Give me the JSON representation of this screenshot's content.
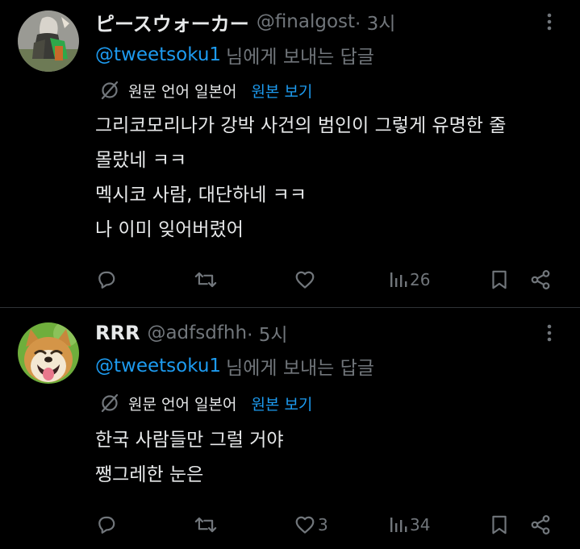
{
  "tweets": [
    {
      "name": "ピースウォーカー",
      "handle": "@finalgost",
      "time": " · 3시",
      "reply_mention": "@tweetsoku1",
      "reply_text": "님에게 보내는 답글",
      "translate_lang": "원문 언어 일본어",
      "translate_link": "원본 보기",
      "lines": [
        "그리코모리나가 강박 사건의 범인이 그렇게 유명한 줄",
        "몰랐네 ㅋㅋ",
        "멕시코 사람, 대단하네 ㅋㅋ",
        "나 이미 잊어버렸어"
      ],
      "stats": {
        "replies": "",
        "retweets": "",
        "likes": "",
        "views": "26"
      }
    },
    {
      "name": "RRR",
      "handle": "@adfsdfhh",
      "time": " · 5시",
      "reply_mention": "@tweetsoku1",
      "reply_text": "님에게 보내는 답글",
      "translate_lang": "원문 언어 일본어",
      "translate_link": "원본 보기",
      "lines": [
        "한국 사람들만 그럴 거야",
        "쨍그레한 눈은"
      ],
      "stats": {
        "replies": "",
        "retweets": "",
        "likes": "3",
        "views": "34"
      }
    }
  ],
  "icons": {
    "reply": "reply-icon",
    "retweet": "retweet-icon",
    "like": "heart-icon",
    "views": "views-bar-icon",
    "bookmark": "bookmark-icon",
    "share": "share-icon",
    "more": "more-vertical-icon",
    "translate": "translate-icon"
  },
  "colors": {
    "background": "#000000",
    "text": "#e7e9ea",
    "secondary": "#71767b",
    "link": "#1d9bf0",
    "divider": "#2f3336"
  }
}
